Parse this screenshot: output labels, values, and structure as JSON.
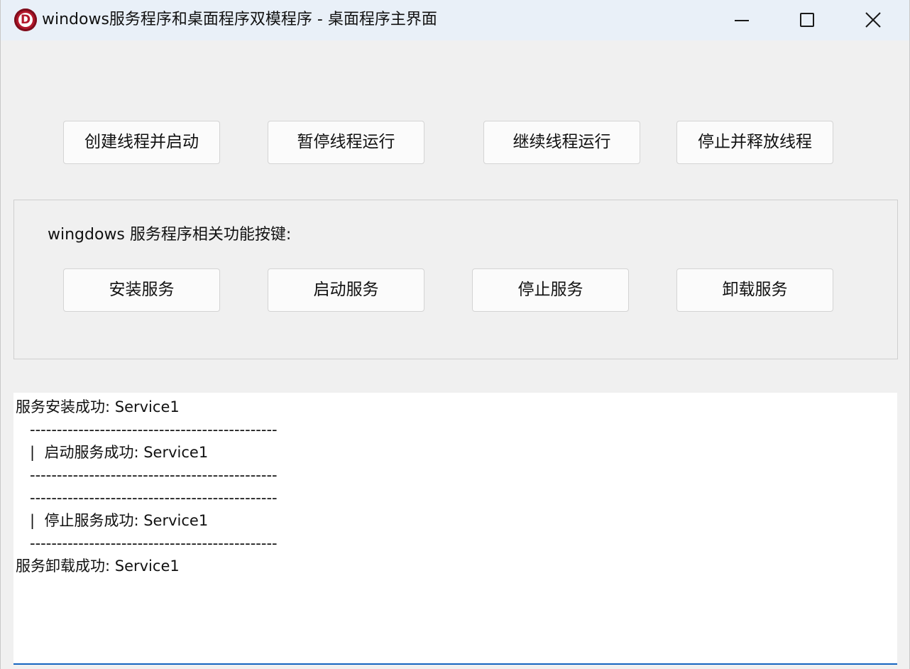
{
  "window": {
    "title": "windows服务程序和桌面程序双模程序 - 桌面程序主界面",
    "icon": "delphi-app-icon",
    "icon_letter": "D"
  },
  "thread_buttons": [
    {
      "label": "创建线程并启动"
    },
    {
      "label": "暂停线程运行"
    },
    {
      "label": "继续线程运行"
    },
    {
      "label": "停止并释放线程"
    }
  ],
  "service_group": {
    "label": "wingdows 服务程序相关功能按键:",
    "buttons": [
      {
        "label": "安装服务"
      },
      {
        "label": "启动服务"
      },
      {
        "label": "停止服务"
      },
      {
        "label": "卸载服务"
      }
    ]
  },
  "log": {
    "lines": [
      "服务安装成功: Service1",
      "   ----------------------------------------------",
      "   |  启动服务成功: Service1",
      "   ----------------------------------------------",
      "   ----------------------------------------------",
      "   |  停止服务成功: Service1",
      "   ----------------------------------------------",
      "服务卸载成功: Service1"
    ]
  },
  "colors": {
    "titlebar": "#e9f0f8",
    "window_bg": "#f0f0f0",
    "log_focus_border": "#1565c0",
    "app_icon": "#b3172b"
  }
}
